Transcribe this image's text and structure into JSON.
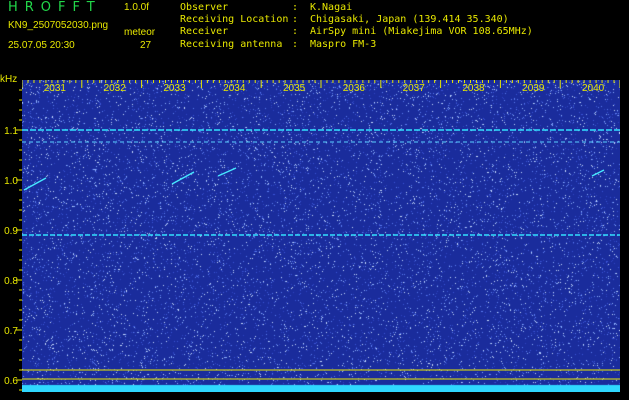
{
  "header": {
    "logo": "HROFFT",
    "version": "1.0.0f",
    "filename": "KN9_2507052030.png",
    "meteor_label": "meteor",
    "datetime": "25.07.05 20:30",
    "meteor_count": "27"
  },
  "info": [
    {
      "key": "Observer",
      "sep": ":",
      "value": "K.Nagai"
    },
    {
      "key": "Receiving Location",
      "sep": ":",
      "value": "Chigasaki, Japan (139.414 35.340)"
    },
    {
      "key": "Receiver",
      "sep": ":",
      "value": "AirSpy mini (Miakejima VOR 108.65MHz)"
    },
    {
      "key": "Receiving antenna",
      "sep": ":",
      "value": "Maspro FM-3"
    }
  ],
  "axis": {
    "y_unit": "kHz",
    "y_ticks": [
      "1.1",
      "1.0",
      "0.9",
      "0.8",
      "0.7",
      "0.6"
    ],
    "x_ticks": [
      "2031",
      "2032",
      "2033",
      "2034",
      "2035",
      "2036",
      "2037",
      "2038",
      "2039",
      "2040"
    ]
  },
  "colors": {
    "background": "#1a2c9c",
    "noise": "#7fa8ff",
    "carrier": "#33e0ff",
    "text": "#e8e800",
    "logo": "#22d84a"
  }
}
